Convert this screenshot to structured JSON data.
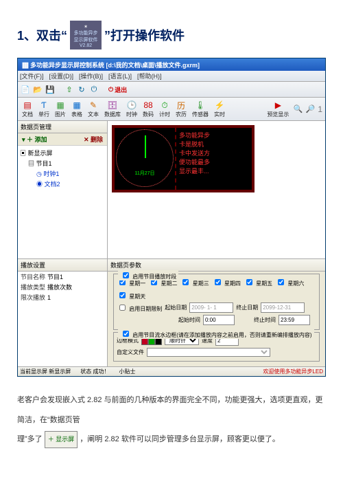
{
  "doc": {
    "step_prefix": "1、双击“",
    "step_suffix": "”打开操作软件",
    "icon_line1": "多功能异步",
    "icon_line2": "显示屏软件",
    "icon_line3": "V2.82",
    "para1_a": "老客户会发现嵌入式 2.82 与前面的几种版本的界面完全不同，功能更强大，选项更直观，更简洁，在“数据页管",
    "para1_b": "理”多了",
    "btn_text": "＋ 显示屏",
    "para1_c": "，阐明 2.82 软件可以同步管理多台显示屏，顾客更以便了。"
  },
  "titlebar": {
    "text": "多功能异步显示屏控制系统 [d:\\我的文档\\桌面\\播放文件.gxrm]"
  },
  "menus": {
    "file": "[文件(F)]",
    "setting": "[设置(D)]",
    "run": "[操作(B)]",
    "lang": "[语言(L)]",
    "help": "[帮助(H)]"
  },
  "top_icons": {
    "exit": "退出"
  },
  "toolbar2": {
    "wendang": "文档",
    "danhang": "单行",
    "tupian": "图片",
    "biaoge": "表格",
    "wenben": "文本",
    "shujuku": "数据库",
    "jishi_clock": "时钟",
    "shuma": "数码",
    "jishi": "计时",
    "nongli": "农历",
    "chuanqi": "传感器",
    "shishi": "实时",
    "preview": "预览显示",
    "zoom": "1"
  },
  "side": {
    "head": "数据页管理",
    "add": "＋ 添加",
    "del": "✕ 删除",
    "root": "新显示屏",
    "node1": "节目1",
    "leaf1": "时钟1",
    "leaf2": "文档2"
  },
  "clock": {
    "date": "11月27日"
  },
  "led": {
    "l1": "多功能异步",
    "l2": "卡是脱机",
    "l3": "卡中发送方",
    "l4": "便功能最多",
    "l5": "显示最丰..."
  },
  "set_left": {
    "head": "播放设置",
    "row1_l": "节目名称",
    "row1_v": "节目1",
    "row2_l": "播放类型",
    "row2_v": "播放次数",
    "row3_l": "限次播放",
    "row3_v": "1"
  },
  "param": {
    "head": "数据页参数",
    "g1_title": "启用节目播放时段",
    "weeks": [
      "星期一",
      "星期二",
      "星期三",
      "星期四",
      "星期五",
      "星期六",
      "星期天"
    ],
    "date_limit": "启用日期限制",
    "start_date_l": "起始日期",
    "start_date_v": "2009- 1- 1",
    "end_date_l": "终止日期",
    "end_date_v": "2099-12-31",
    "start_time_l": "起始时间",
    "start_time_v": "0:00",
    "end_time_l": "终止时间",
    "end_time_v": "23:59",
    "g2_title": "启用节目流水边框(请在添加播放内容之前启用，否则请重新编排播放内容)",
    "border_style": "边框模式",
    "direction": "顺时针",
    "speed_l": "速度",
    "speed_v": "2",
    "custom": "自定义文件"
  },
  "status": {
    "screen": "当前显示屏",
    "screen_v": "新显示屏",
    "state": "状态",
    "state_v": "成功！",
    "tip": "小贴士",
    "right": "欢迎使用多功能异步LED"
  }
}
